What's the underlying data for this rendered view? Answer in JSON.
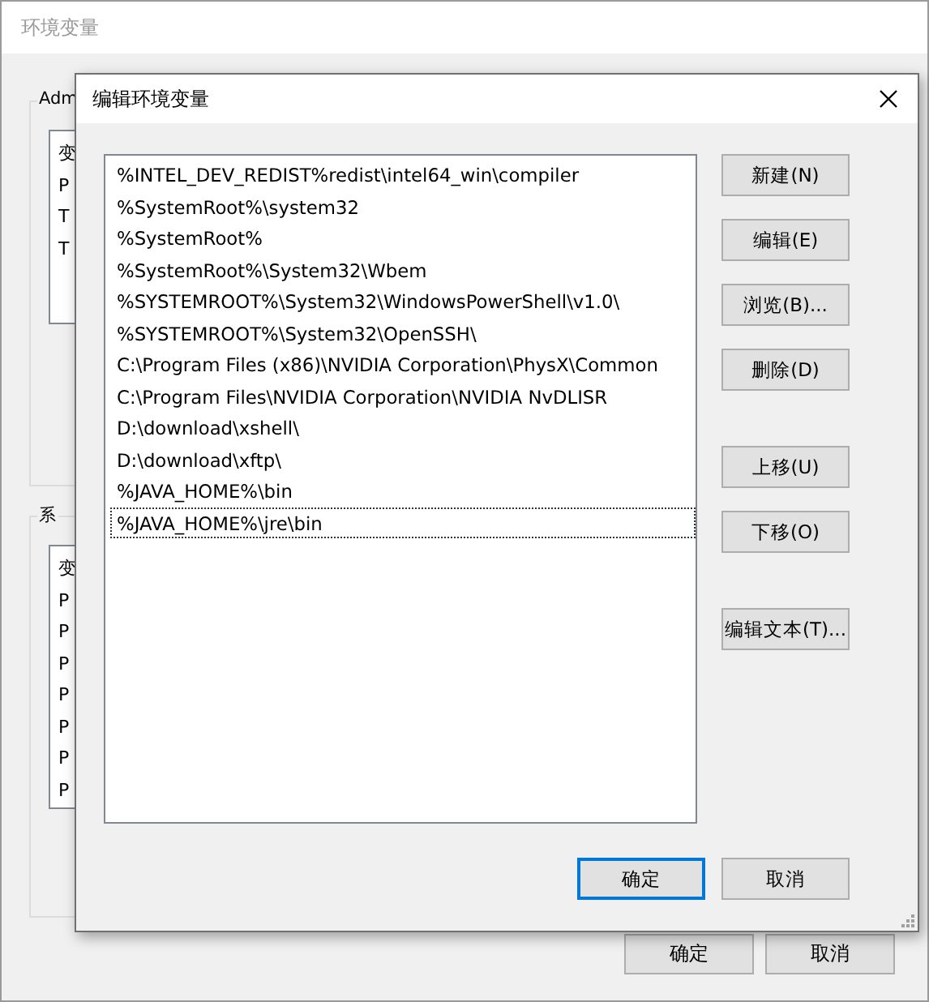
{
  "background_window": {
    "title": "环境变量",
    "user_group": {
      "label": "Adm",
      "rows": [
        "变",
        "P",
        "T",
        "T"
      ]
    },
    "system_group": {
      "label": "系",
      "rows": [
        "变",
        "P",
        "P",
        "P",
        "P",
        "P",
        "P",
        "P"
      ]
    },
    "buttons": [
      "确定",
      "取消"
    ]
  },
  "dialog": {
    "title": "编辑环境变量",
    "paths": [
      {
        "text": "%INTEL_DEV_REDIST%redist\\intel64_win\\compiler",
        "focused": false
      },
      {
        "text": "%SystemRoot%\\system32",
        "focused": false
      },
      {
        "text": "%SystemRoot%",
        "focused": false
      },
      {
        "text": "%SystemRoot%\\System32\\Wbem",
        "focused": false
      },
      {
        "text": "%SYSTEMROOT%\\System32\\WindowsPowerShell\\v1.0\\",
        "focused": false
      },
      {
        "text": "%SYSTEMROOT%\\System32\\OpenSSH\\",
        "focused": false
      },
      {
        "text": "C:\\Program Files (x86)\\NVIDIA Corporation\\PhysX\\Common",
        "focused": false
      },
      {
        "text": "C:\\Program Files\\NVIDIA Corporation\\NVIDIA NvDLISR",
        "focused": false
      },
      {
        "text": "D:\\download\\xshell\\",
        "focused": false
      },
      {
        "text": "D:\\download\\xftp\\",
        "focused": false
      },
      {
        "text": "%JAVA_HOME%\\bin",
        "focused": false
      },
      {
        "text": "%JAVA_HOME%\\jre\\bin",
        "focused": true
      }
    ],
    "side_button_groups": [
      [
        "新建(N)",
        "编辑(E)",
        "浏览(B)...",
        "删除(D)"
      ],
      [
        "上移(U)",
        "下移(O)"
      ],
      [
        "编辑文本(T)..."
      ]
    ],
    "buttons": [
      {
        "label": "确定",
        "default": true
      },
      {
        "label": "取消",
        "default": false
      }
    ]
  }
}
